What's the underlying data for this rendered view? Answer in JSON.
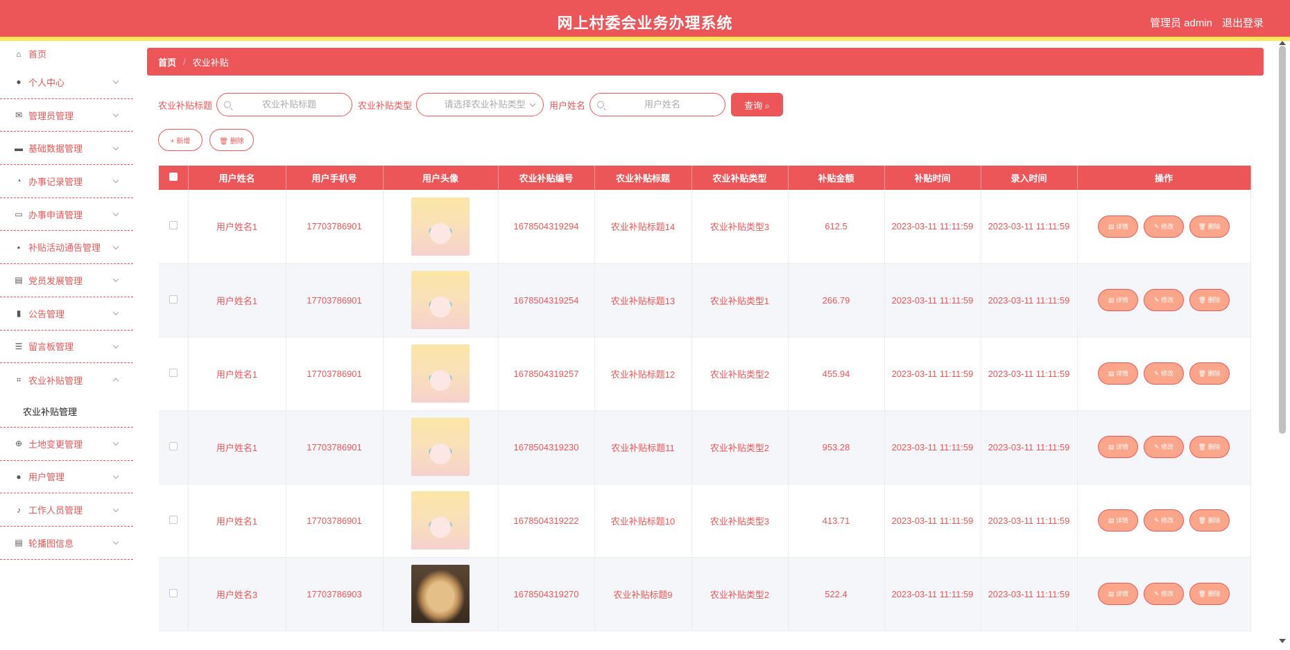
{
  "header": {
    "title": "网上村委会业务办理系统",
    "user": "管理员 admin",
    "logout": "退出登录"
  },
  "sidebar": {
    "items": [
      {
        "label": "首页",
        "icon": "home-icon"
      },
      {
        "label": "个人中心",
        "icon": "user-icon"
      },
      {
        "label": "管理员管理",
        "icon": "mail-icon"
      },
      {
        "label": "基础数据管理",
        "icon": "flag-icon"
      },
      {
        "label": "办事记录管理",
        "icon": "gauge-icon"
      },
      {
        "label": "办事申请管理",
        "icon": "monitor-icon"
      },
      {
        "label": "补贴活动通告管理",
        "icon": "chat-icon"
      },
      {
        "label": "党员发展管理",
        "icon": "clipboard-icon"
      },
      {
        "label": "公告管理",
        "icon": "bar-chart-icon"
      },
      {
        "label": "留言板管理",
        "icon": "list-icon"
      },
      {
        "label": "农业补贴管理",
        "icon": "crop-icon"
      },
      {
        "label": "土地变更管理",
        "icon": "compass-icon"
      },
      {
        "label": "用户管理",
        "icon": "person-icon"
      },
      {
        "label": "工作人员管理",
        "icon": "mic-icon"
      },
      {
        "label": "轮播图信息",
        "icon": "clipboard-check-icon"
      }
    ],
    "submenu": "农业补贴管理"
  },
  "breadcrumb": {
    "home": "首页",
    "current": "农业补贴"
  },
  "search": {
    "title_label": "农业补贴标题",
    "title_placeholder": "农业补贴标题",
    "type_label": "农业补贴类型",
    "type_placeholder": "请选择农业补贴类型",
    "name_label": "用户姓名",
    "name_placeholder": "用户姓名",
    "button": "查询"
  },
  "actions": {
    "add": "+ 新增",
    "delete": "🗑 删除"
  },
  "table": {
    "headers": [
      "用户姓名",
      "用户手机号",
      "用户头像",
      "农业补贴编号",
      "农业补贴标题",
      "农业补贴类型",
      "补贴金额",
      "补贴时间",
      "录入时间",
      "操作"
    ],
    "rows": [
      {
        "name": "用户姓名1",
        "phone": "17703786901",
        "avatar": "anime",
        "code": "1678504319294",
        "title": "农业补贴标题14",
        "type": "农业补贴类型3",
        "amount": "612.5",
        "subsidy_time": "2023-03-11 11:11:59",
        "entry_time": "2023-03-11 11:11:59"
      },
      {
        "name": "用户姓名1",
        "phone": "17703786901",
        "avatar": "anime",
        "code": "1678504319254",
        "title": "农业补贴标题13",
        "type": "农业补贴类型1",
        "amount": "266.79",
        "subsidy_time": "2023-03-11 11:11:59",
        "entry_time": "2023-03-11 11:11:59"
      },
      {
        "name": "用户姓名1",
        "phone": "17703786901",
        "avatar": "anime",
        "code": "1678504319257",
        "title": "农业补贴标题12",
        "type": "农业补贴类型2",
        "amount": "455.94",
        "subsidy_time": "2023-03-11 11:11:59",
        "entry_time": "2023-03-11 11:11:59"
      },
      {
        "name": "用户姓名1",
        "phone": "17703786901",
        "avatar": "anime",
        "code": "1678504319230",
        "title": "农业补贴标题11",
        "type": "农业补贴类型2",
        "amount": "953.28",
        "subsidy_time": "2023-03-11 11:11:59",
        "entry_time": "2023-03-11 11:11:59"
      },
      {
        "name": "用户姓名1",
        "phone": "17703786901",
        "avatar": "anime",
        "code": "1678504319222",
        "title": "农业补贴标题10",
        "type": "农业补贴类型3",
        "amount": "413.71",
        "subsidy_time": "2023-03-11 11:11:59",
        "entry_time": "2023-03-11 11:11:59"
      },
      {
        "name": "用户姓名3",
        "phone": "17703786903",
        "avatar": "dog",
        "code": "1678504319270",
        "title": "农业补贴标题9",
        "type": "农业补贴类型2",
        "amount": "522.4",
        "subsidy_time": "2023-03-11 11:11:59",
        "entry_time": "2023-03-11 11:11:59"
      }
    ],
    "row_buttons": {
      "detail": "详情",
      "edit": "修改",
      "delete": "删除"
    }
  },
  "colors": {
    "primary": "#ec5658",
    "accent_yellow": "#fde85a",
    "button_fill": "#fba68a"
  }
}
